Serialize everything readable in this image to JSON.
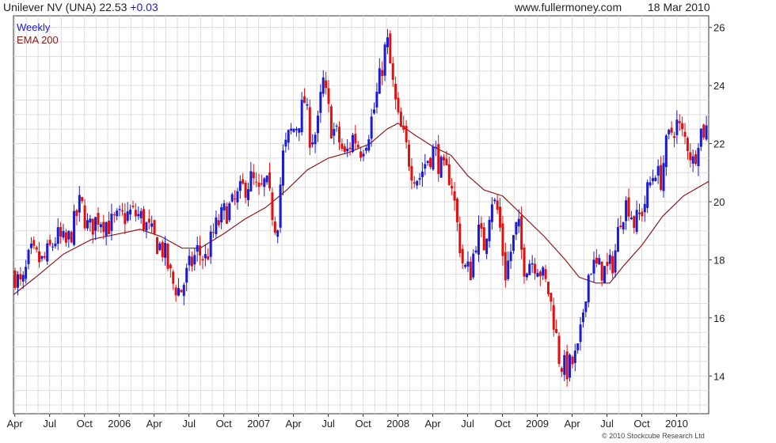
{
  "header": {
    "title": "Unilever NV (UNA) 22.53",
    "change": "+0.03",
    "site": "www.fullermoney.com",
    "date": "18 Mar 2010"
  },
  "legend": {
    "weekly": "Weekly",
    "ema": "EMA 200"
  },
  "copyright": "© 2010 Stockcube Research Ltd",
  "colors": {
    "up": "#1b1bd0",
    "down": "#e01010",
    "ema": "#8b1a1a",
    "grid": "#dcdcdc",
    "axis": "#333333"
  },
  "chart_data": {
    "type": "candlestick",
    "title": "Unilever NV (UNA) 22.53 +0.03",
    "ylim": [
      12.7,
      26.4
    ],
    "y_ticks": [
      14,
      16,
      18,
      20,
      22,
      24,
      26
    ],
    "x_range": [
      2005.24,
      2010.23
    ],
    "x_ticks": [
      {
        "label": "Apr",
        "x": 2005.25
      },
      {
        "label": "Jul",
        "x": 2005.5
      },
      {
        "label": "Oct",
        "x": 2005.75
      },
      {
        "label": "2006",
        "x": 2006.0
      },
      {
        "label": "Apr",
        "x": 2006.25
      },
      {
        "label": "Jul",
        "x": 2006.5
      },
      {
        "label": "Oct",
        "x": 2006.75
      },
      {
        "label": "2007",
        "x": 2007.0
      },
      {
        "label": "Apr",
        "x": 2007.25
      },
      {
        "label": "Jul",
        "x": 2007.5
      },
      {
        "label": "Oct",
        "x": 2007.75
      },
      {
        "label": "2008",
        "x": 2008.0
      },
      {
        "label": "Apr",
        "x": 2008.25
      },
      {
        "label": "Jul",
        "x": 2008.5
      },
      {
        "label": "Oct",
        "x": 2008.75
      },
      {
        "label": "2009",
        "x": 2009.0
      },
      {
        "label": "Apr",
        "x": 2009.25
      },
      {
        "label": "Jul",
        "x": 2009.5
      },
      {
        "label": "Oct",
        "x": 2009.75
      },
      {
        "label": "2010",
        "x": 2010.0
      }
    ],
    "close_path": [
      [
        2005.25,
        17.5
      ],
      [
        2005.3,
        17.0
      ],
      [
        2005.36,
        18.2
      ],
      [
        2005.45,
        17.9
      ],
      [
        2005.55,
        18.8
      ],
      [
        2005.62,
        18.5
      ],
      [
        2005.68,
        19.3
      ],
      [
        2005.72,
        20.0
      ],
      [
        2005.78,
        19.0
      ],
      [
        2005.85,
        19.5
      ],
      [
        2005.93,
        19.2
      ],
      [
        2006.0,
        19.4
      ],
      [
        2006.08,
        19.6
      ],
      [
        2006.15,
        19.5
      ],
      [
        2006.2,
        19.1
      ],
      [
        2006.25,
        18.7
      ],
      [
        2006.32,
        18.3
      ],
      [
        2006.38,
        17.2
      ],
      [
        2006.44,
        16.9
      ],
      [
        2006.5,
        17.7
      ],
      [
        2006.56,
        18.3
      ],
      [
        2006.62,
        18.0
      ],
      [
        2006.68,
        19.0
      ],
      [
        2006.75,
        19.6
      ],
      [
        2006.82,
        19.9
      ],
      [
        2006.88,
        20.4
      ],
      [
        2006.95,
        20.8
      ],
      [
        2007.0,
        20.2
      ],
      [
        2007.05,
        20.7
      ],
      [
        2007.1,
        19.6
      ],
      [
        2007.13,
        19.0
      ],
      [
        2007.17,
        21.5
      ],
      [
        2007.22,
        22.3
      ],
      [
        2007.28,
        22.7
      ],
      [
        2007.33,
        23.5
      ],
      [
        2007.37,
        22.2
      ],
      [
        2007.42,
        22.4
      ],
      [
        2007.46,
        24.2
      ],
      [
        2007.52,
        22.6
      ],
      [
        2007.57,
        22.2
      ],
      [
        2007.62,
        21.5
      ],
      [
        2007.68,
        22.3
      ],
      [
        2007.73,
        21.8
      ],
      [
        2007.78,
        22.3
      ],
      [
        2007.83,
        23.2
      ],
      [
        2007.88,
        24.5
      ],
      [
        2007.92,
        25.6
      ],
      [
        2007.96,
        24.1
      ],
      [
        2008.0,
        22.8
      ],
      [
        2008.05,
        22.0
      ],
      [
        2008.1,
        21.1
      ],
      [
        2008.15,
        20.8
      ],
      [
        2008.2,
        21.4
      ],
      [
        2008.26,
        21.8
      ],
      [
        2008.32,
        21.0
      ],
      [
        2008.38,
        20.9
      ],
      [
        2008.43,
        19.0
      ],
      [
        2008.47,
        17.7
      ],
      [
        2008.52,
        17.6
      ],
      [
        2008.57,
        19.0
      ],
      [
        2008.62,
        18.5
      ],
      [
        2008.67,
        20.2
      ],
      [
        2008.72,
        19.6
      ],
      [
        2008.77,
        17.5
      ],
      [
        2008.82,
        18.5
      ],
      [
        2008.86,
        19.3
      ],
      [
        2008.9,
        17.8
      ],
      [
        2008.95,
        18.0
      ],
      [
        2009.0,
        17.9
      ],
      [
        2009.04,
        17.4
      ],
      [
        2009.08,
        16.9
      ],
      [
        2009.12,
        15.9
      ],
      [
        2009.16,
        14.5
      ],
      [
        2009.21,
        14.2
      ],
      [
        2009.26,
        14.5
      ],
      [
        2009.3,
        14.9
      ],
      [
        2009.34,
        16.8
      ],
      [
        2009.38,
        17.8
      ],
      [
        2009.44,
        17.7
      ],
      [
        2009.5,
        17.6
      ],
      [
        2009.55,
        18.0
      ],
      [
        2009.6,
        19.6
      ],
      [
        2009.65,
        20.0
      ],
      [
        2009.7,
        19.2
      ],
      [
        2009.76,
        19.8
      ],
      [
        2009.8,
        20.5
      ],
      [
        2009.85,
        21.2
      ],
      [
        2009.88,
        20.6
      ],
      [
        2009.92,
        21.8
      ],
      [
        2009.96,
        22.4
      ],
      [
        2010.0,
        22.7
      ],
      [
        2010.04,
        22.3
      ],
      [
        2010.08,
        22.0
      ],
      [
        2010.12,
        21.3
      ],
      [
        2010.16,
        22.4
      ],
      [
        2010.21,
        22.5
      ]
    ],
    "ema_path": [
      [
        2005.24,
        16.8
      ],
      [
        2005.4,
        17.4
      ],
      [
        2005.6,
        18.2
      ],
      [
        2005.8,
        18.7
      ],
      [
        2006.0,
        18.9
      ],
      [
        2006.15,
        19.05
      ],
      [
        2006.3,
        18.8
      ],
      [
        2006.45,
        18.4
      ],
      [
        2006.58,
        18.4
      ],
      [
        2006.75,
        18.9
      ],
      [
        2006.9,
        19.4
      ],
      [
        2007.05,
        19.8
      ],
      [
        2007.2,
        20.4
      ],
      [
        2007.35,
        21.1
      ],
      [
        2007.5,
        21.5
      ],
      [
        2007.65,
        21.7
      ],
      [
        2007.8,
        22.0
      ],
      [
        2007.92,
        22.5
      ],
      [
        2008.0,
        22.7
      ],
      [
        2008.12,
        22.3
      ],
      [
        2008.25,
        21.9
      ],
      [
        2008.38,
        21.6
      ],
      [
        2008.5,
        20.9
      ],
      [
        2008.62,
        20.4
      ],
      [
        2008.75,
        20.2
      ],
      [
        2008.9,
        19.5
      ],
      [
        2009.05,
        18.8
      ],
      [
        2009.2,
        18.0
      ],
      [
        2009.3,
        17.4
      ],
      [
        2009.42,
        17.2
      ],
      [
        2009.52,
        17.2
      ],
      [
        2009.62,
        17.8
      ],
      [
        2009.75,
        18.5
      ],
      [
        2009.9,
        19.5
      ],
      [
        2010.05,
        20.2
      ],
      [
        2010.23,
        20.7
      ]
    ]
  }
}
